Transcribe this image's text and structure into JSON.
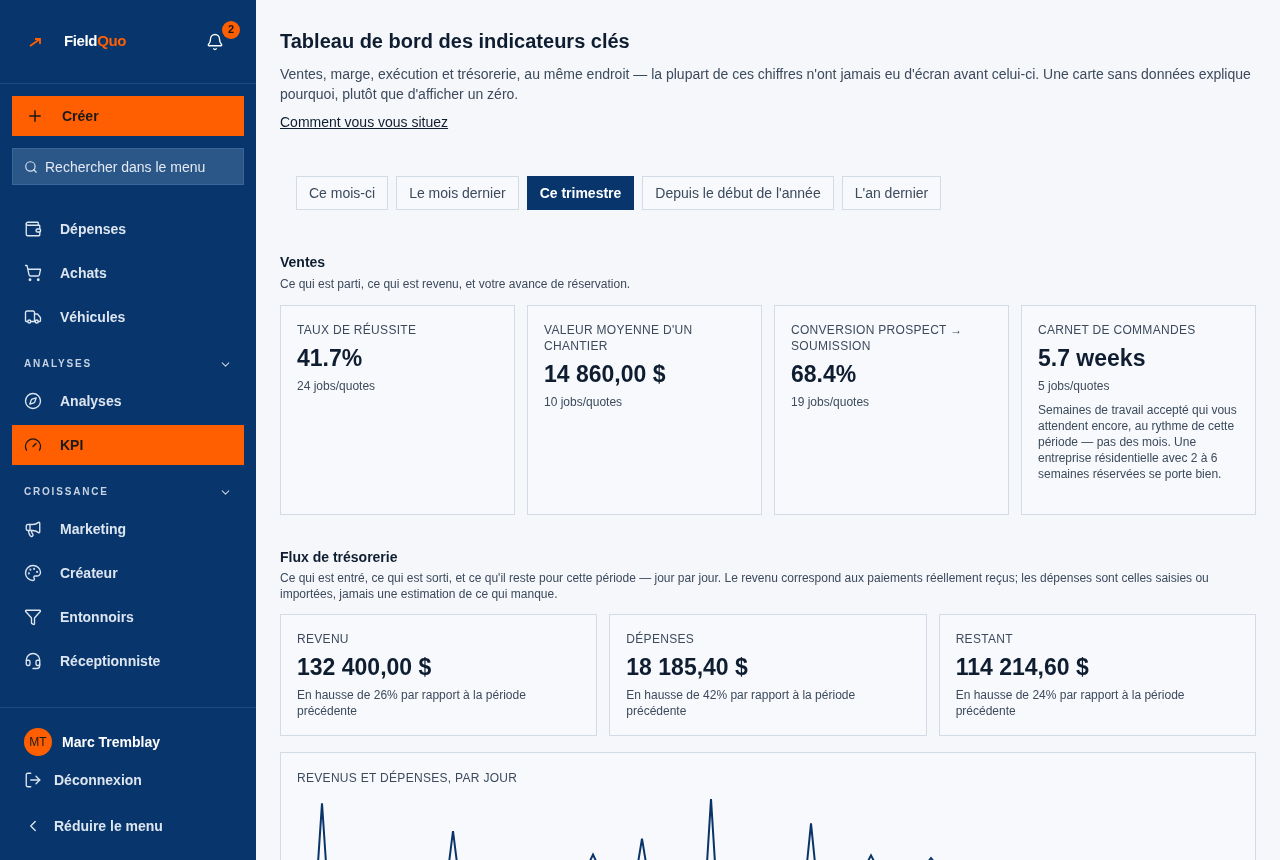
{
  "sidebar": {
    "brand": {
      "first": "Field",
      "second": "Quo"
    },
    "notifications": {
      "count": "2"
    },
    "create_button": "Créer",
    "search": {
      "placeholder": "Rechercher dans le menu"
    },
    "nav": [
      {
        "kind": "item",
        "label": "Dépenses",
        "selected": false
      },
      {
        "kind": "item",
        "label": "Achats",
        "selected": false
      },
      {
        "kind": "item",
        "label": "Véhicules",
        "selected": false
      },
      {
        "kind": "section",
        "label": "ANALYSES",
        "expanded": true
      },
      {
        "kind": "item",
        "label": "Analyses",
        "selected": false
      },
      {
        "kind": "item",
        "label": "KPI",
        "selected": true
      },
      {
        "kind": "section",
        "label": "CROISSANCE",
        "expanded": true
      },
      {
        "kind": "item",
        "label": "Marketing",
        "selected": false
      },
      {
        "kind": "item",
        "label": "Créateur",
        "selected": false
      },
      {
        "kind": "item",
        "label": "Entonnoirs",
        "selected": false
      },
      {
        "kind": "item",
        "label": "Réceptionniste",
        "selected": false
      }
    ],
    "user": {
      "initials": "MT",
      "name": "Marc Tremblay"
    },
    "footer_actions": [
      {
        "label": "Déconnexion"
      },
      {
        "label": "Réduire le menu"
      }
    ]
  },
  "page": {
    "title": "Tableau de bord des indicateurs clés",
    "description": "Ventes, marge, exécution et trésorerie, au même endroit — la plupart de ces chiffres n'ont jamais eu d'écran avant celui-ci. Une carte sans données explique pourquoi, plutôt que d'afficher un zéro.",
    "link": "Comment vous vous situez"
  },
  "periods": [
    {
      "label": "Ce mois-ci",
      "selected": false
    },
    {
      "label": "Le mois dernier",
      "selected": false
    },
    {
      "label": "Ce trimestre",
      "selected": true
    },
    {
      "label": "Depuis le début de l'année",
      "selected": false
    },
    {
      "label": "L'an dernier",
      "selected": false
    }
  ],
  "sales": {
    "title": "Ventes",
    "subtitle": "Ce qui est parti, ce qui est revenu, et votre avance de réservation.",
    "cards": [
      {
        "label": "TAUX DE RÉUSSITE",
        "value": "41.7%",
        "detail": "24 jobs/quotes"
      },
      {
        "label": "VALEUR MOYENNE D'UN CHANTIER",
        "value": "14 860,00 $",
        "detail": "10 jobs/quotes"
      },
      {
        "label": "CONVERSION PROSPECT → SOUMISSION",
        "value": "68.4%",
        "detail": "19 jobs/quotes"
      },
      {
        "label": "CARNET DE COMMANDES",
        "value": "5.7 weeks",
        "detail": "5 jobs/quotes",
        "note": "Semaines de travail accepté qui vous attendent encore, au rythme de cette période — pas des mois. Une entreprise résidentielle avec 2 à 6 semaines réservées se porte bien."
      }
    ]
  },
  "cash": {
    "title": "Flux de trésorerie",
    "subtitle": "Ce qui est entré, ce qui est sorti, et ce qu'il reste pour cette période — jour par jour. Le revenu correspond aux paiements réellement reçus; les dépenses sont celles saisies ou importées, jamais une estimation de ce qui manque.",
    "cards": [
      {
        "label": "REVENU",
        "value": "132 400,00 $",
        "detail": "En hausse de 26% par rapport à la période précédente"
      },
      {
        "label": "DÉPENSES",
        "value": "18 185,40 $",
        "detail": "En hausse de 42% par rapport à la période précédente"
      },
      {
        "label": "RESTANT",
        "value": "114 214,60 $",
        "detail": "En hausse de 24% par rapport à la période précédente"
      }
    ],
    "chart": {
      "title": "REVENUS ET DÉPENSES, PAR JOUR"
    }
  }
}
